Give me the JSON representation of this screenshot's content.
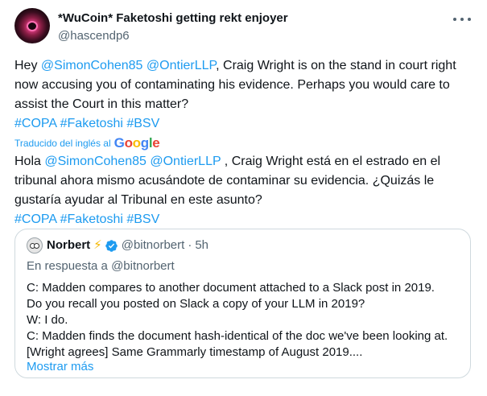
{
  "author": {
    "display_name": "*WuCoin* Faketoshi getting rekt enjoyer",
    "handle": "@hascendp6",
    "avatar_icon": "avatar-icon"
  },
  "more_icon": "more-horizontal-icon",
  "tweet": {
    "greeting": "Hey ",
    "mention_1": "@SimonCohen85",
    "space": " ",
    "mention_2": "@OntierLLP",
    "text_rest": ", Craig Wright is on the stand in court right now accusing you of contaminating his evidence. Perhaps you would care to assist the Court in this matter?",
    "hashtag_1": "#COPA",
    "hashtag_2": "#Faketoshi",
    "hashtag_3": "#BSV"
  },
  "translation": {
    "label": "Traducido del inglés al",
    "provider": "Google",
    "greeting": "Hola ",
    "mention_1": "@SimonCohen85",
    "mention_2": "@OntierLLP",
    "text_rest": " , Craig Wright está en el estrado en el tribunal ahora mismo acusándote de contaminar su evidencia. ¿Quizás le gustaría ayudar al Tribunal en este asunto?",
    "hashtag_1": "#COPA",
    "hashtag_2": "#Faketoshi",
    "hashtag_3": "#BSV"
  },
  "quote": {
    "name": "Norbert",
    "lightning": "⚡",
    "handle": "@bitnorbert",
    "dot": "·",
    "time": "5h",
    "reply_context": "En respuesta a @bitnorbert",
    "lines": [
      "C: Madden compares to another document attached to a Slack post in 2019.",
      "Do you recall you posted on Slack a copy of your LLM in 2019?",
      "W: I do.",
      "C: Madden finds the document hash-identical of the doc we've been looking at. [Wright agrees] Same Grammarly timestamp of August 2019...."
    ],
    "show_more": "Mostrar más"
  },
  "colors": {
    "link": "#1d9bf0",
    "text": "#0f1419",
    "secondary": "#536471",
    "border": "#cfd9de"
  }
}
